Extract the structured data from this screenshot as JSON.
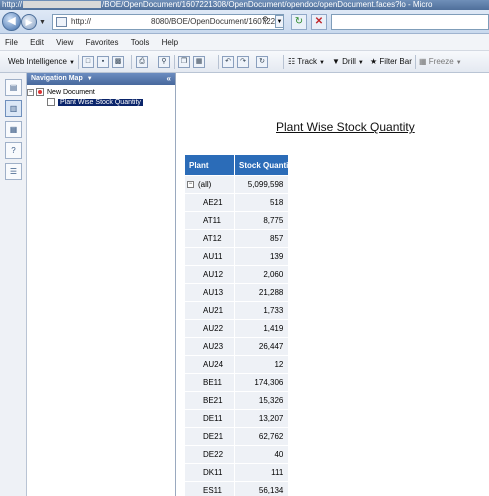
{
  "browser": {
    "title_prefix": "http://",
    "title_suffix": "/BOE/OpenDocument/1607221308/OpenDocument/opendoc/openDocument.faces?lo - Micro",
    "address_prefix": "http://",
    "address_suffix": "8080/BOE/OpenDocument/1607221",
    "menu": [
      "File",
      "Edit",
      "View",
      "Favorites",
      "Tools",
      "Help"
    ]
  },
  "toolbar": {
    "web_intelligence": "Web Intelligence",
    "track": "Track",
    "drill": "Drill",
    "filter_bar": "Filter Bar",
    "freeze": "Freeze"
  },
  "nav_map": {
    "title": "Navigation Map",
    "root": "New Document",
    "child": "Plant Wise Stock Quantity"
  },
  "report": {
    "title": "Plant Wise Stock Quantity",
    "columns": [
      "Plant",
      "Stock Quanti"
    ],
    "all_label": "(all)",
    "all_value": "5,099,598",
    "rows": [
      {
        "plant": "AE21",
        "qty": "518"
      },
      {
        "plant": "AT11",
        "qty": "8,775"
      },
      {
        "plant": "AT12",
        "qty": "857"
      },
      {
        "plant": "AU11",
        "qty": "139"
      },
      {
        "plant": "AU12",
        "qty": "2,060"
      },
      {
        "plant": "AU13",
        "qty": "21,288"
      },
      {
        "plant": "AU21",
        "qty": "1,733"
      },
      {
        "plant": "AU22",
        "qty": "1,419"
      },
      {
        "plant": "AU23",
        "qty": "26,447"
      },
      {
        "plant": "AU24",
        "qty": "12"
      },
      {
        "plant": "BE11",
        "qty": "174,306"
      },
      {
        "plant": "BE21",
        "qty": "15,326"
      },
      {
        "plant": "DE11",
        "qty": "13,207"
      },
      {
        "plant": "DE21",
        "qty": "62,762"
      },
      {
        "plant": "DE22",
        "qty": "40"
      },
      {
        "plant": "DK11",
        "qty": "111"
      },
      {
        "plant": "ES11",
        "qty": "56,134"
      }
    ]
  }
}
